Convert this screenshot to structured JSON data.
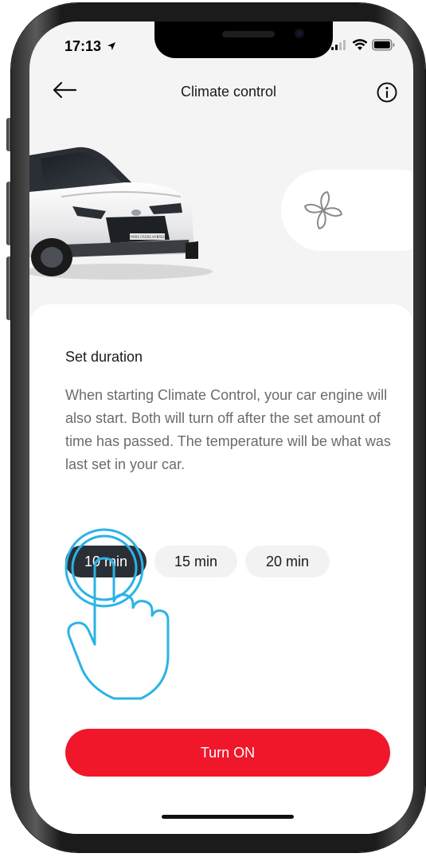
{
  "status_bar": {
    "time": "17:13"
  },
  "header": {
    "title": "Climate control",
    "back_icon": "arrow-left-icon",
    "info_icon": "info-icon"
  },
  "car": {
    "plate_text": "YARIS CROSS HYBRID"
  },
  "fan_toggle": {
    "icon": "fan-icon"
  },
  "duration": {
    "title": "Set duration",
    "description": "When starting Climate Control, your car engine will also start. Both will turn off after the set amount of time has passed. The temperature will be what was last set in your car.",
    "options": [
      {
        "label": "10 min",
        "selected": true
      },
      {
        "label": "15 min",
        "selected": false
      },
      {
        "label": "20 min",
        "selected": false
      }
    ]
  },
  "action": {
    "turn_on_label": "Turn ON"
  },
  "colors": {
    "accent": "#f0172a",
    "selected_chip": "#2a2f36",
    "tap_hint": "#2bb3e6"
  }
}
